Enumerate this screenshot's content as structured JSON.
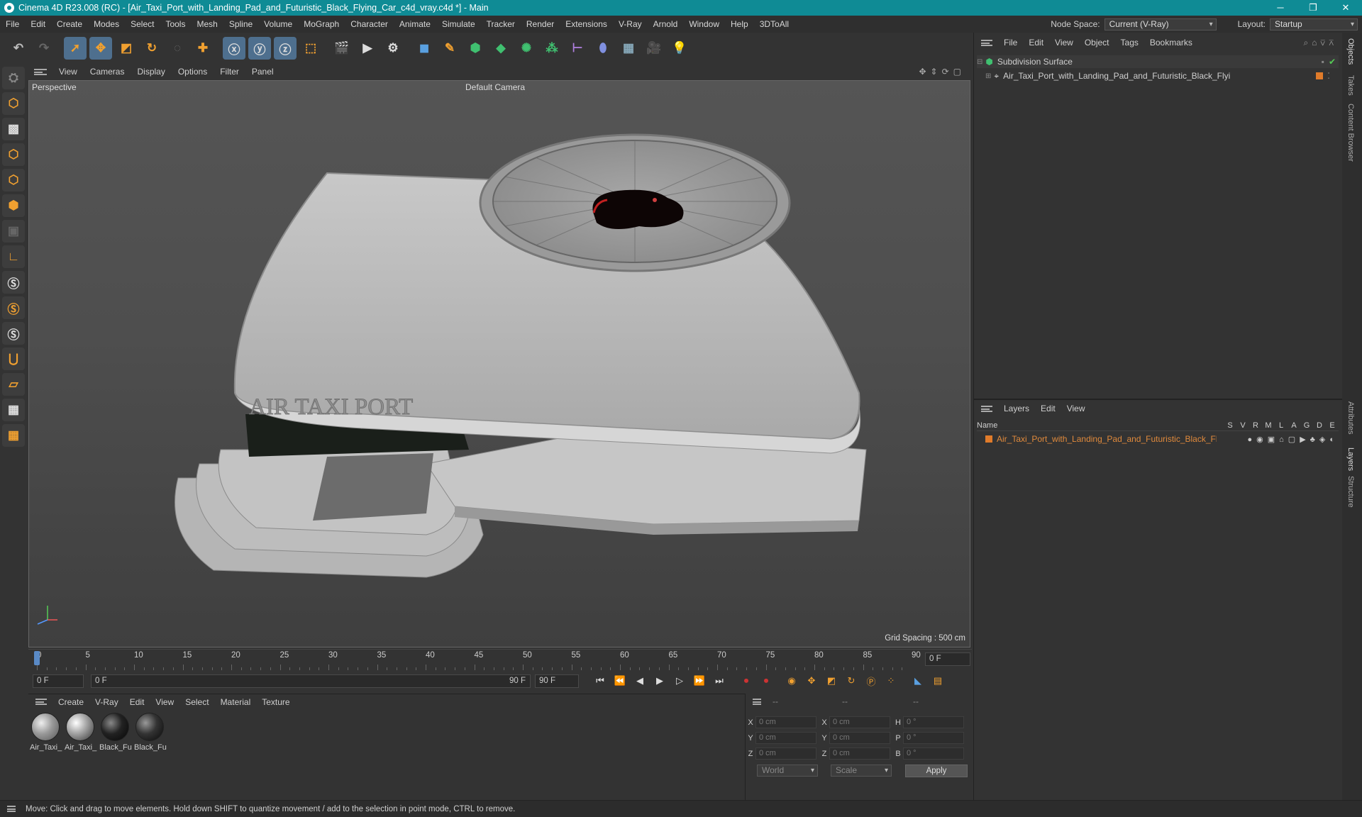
{
  "window": {
    "title": "Cinema 4D R23.008 (RC) - [Air_Taxi_Port_with_Landing_Pad_and_Futuristic_Black_Flying_Car_c4d_vray.c4d *] - Main"
  },
  "menu": [
    "File",
    "Edit",
    "Create",
    "Modes",
    "Select",
    "Tools",
    "Mesh",
    "Spline",
    "Volume",
    "MoGraph",
    "Character",
    "Animate",
    "Simulate",
    "Tracker",
    "Render",
    "Extensions",
    "V-Ray",
    "Arnold",
    "Window",
    "Help",
    "3DToAll"
  ],
  "nodespace": {
    "label": "Node Space:",
    "value": "Current (V-Ray)",
    "layout_label": "Layout:",
    "layout_value": "Startup"
  },
  "viewport": {
    "menu": [
      "View",
      "Cameras",
      "Display",
      "Options",
      "Filter",
      "Panel"
    ],
    "label": "Perspective",
    "camera": "Default Camera",
    "grid": "Grid Spacing : 500 cm",
    "sign": "AIR TAXI PORT"
  },
  "timeline": {
    "ticks": [
      "0",
      "5",
      "10",
      "15",
      "20",
      "25",
      "30",
      "35",
      "40",
      "45",
      "50",
      "55",
      "60",
      "65",
      "70",
      "75",
      "80",
      "85",
      "90"
    ],
    "frame_field": "0 F"
  },
  "playback": {
    "start": "0 F",
    "current": "0 F",
    "end_marker": "90 F",
    "end": "90 F"
  },
  "materials": {
    "menu": [
      "Create",
      "V-Ray",
      "Edit",
      "View",
      "Select",
      "Material",
      "Texture"
    ],
    "items": [
      "Air_Taxi_",
      "Air_Taxi_",
      "Black_Fu",
      "Black_Fu"
    ]
  },
  "coords": {
    "rows": [
      {
        "a": "X",
        "av": "0 cm",
        "b": "X",
        "bv": "0 cm",
        "c": "H",
        "cv": "0 °"
      },
      {
        "a": "Y",
        "av": "0 cm",
        "b": "Y",
        "bv": "0 cm",
        "c": "P",
        "cv": "0 °"
      },
      {
        "a": "Z",
        "av": "0 cm",
        "b": "Z",
        "bv": "0 cm",
        "c": "B",
        "cv": "0 °"
      }
    ],
    "world": "World",
    "scale": "Scale",
    "apply": "Apply",
    "dashes": [
      "--",
      "--",
      "--"
    ]
  },
  "objects": {
    "menu": [
      "File",
      "Edit",
      "View",
      "Object",
      "Tags",
      "Bookmarks"
    ],
    "items": [
      {
        "name": "Subdivision Surface"
      },
      {
        "name": "Air_Taxi_Port_with_Landing_Pad_and_Futuristic_Black_Flying_Car"
      }
    ]
  },
  "layers": {
    "menu": [
      "Layers",
      "Edit",
      "View"
    ],
    "header_name": "Name",
    "cols": [
      "S",
      "V",
      "R",
      "M",
      "L",
      "A",
      "G",
      "D",
      "E"
    ],
    "item": "Air_Taxi_Port_with_Landing_Pad_and_Futuristic_Black_Flying_Car"
  },
  "sidetabs": [
    "Objects",
    "Takes",
    "Content Browser",
    "Attributes",
    "Layers",
    "Structure"
  ],
  "status": "Move: Click and drag to move elements. Hold down SHIFT to quantize movement / add to the selection in point mode, CTRL to remove."
}
